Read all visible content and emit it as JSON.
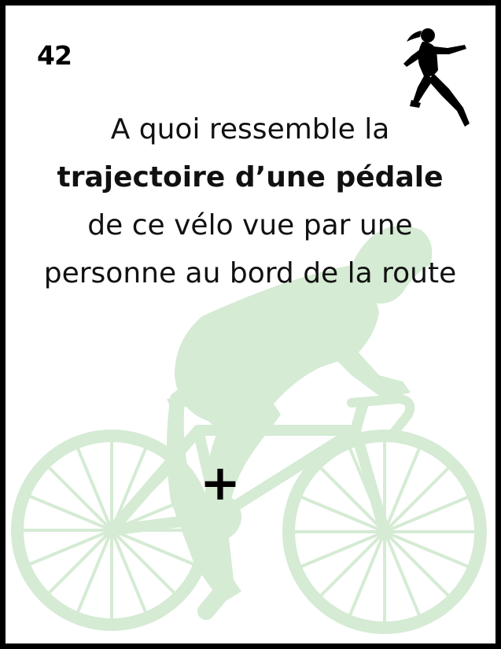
{
  "card": {
    "number": "42",
    "question": {
      "part1": "A quoi ressemble la ",
      "bold1": "trajectoire d’une pédale",
      "part2": " de ce vélo vue par une personne au bord de la route"
    },
    "marker": "+"
  },
  "illustrations": {
    "corner": "runner-icon",
    "background": "cyclist-icon"
  },
  "colors": {
    "border": "#000000",
    "text": "#111111",
    "cyclist": "#d5ebd4"
  }
}
